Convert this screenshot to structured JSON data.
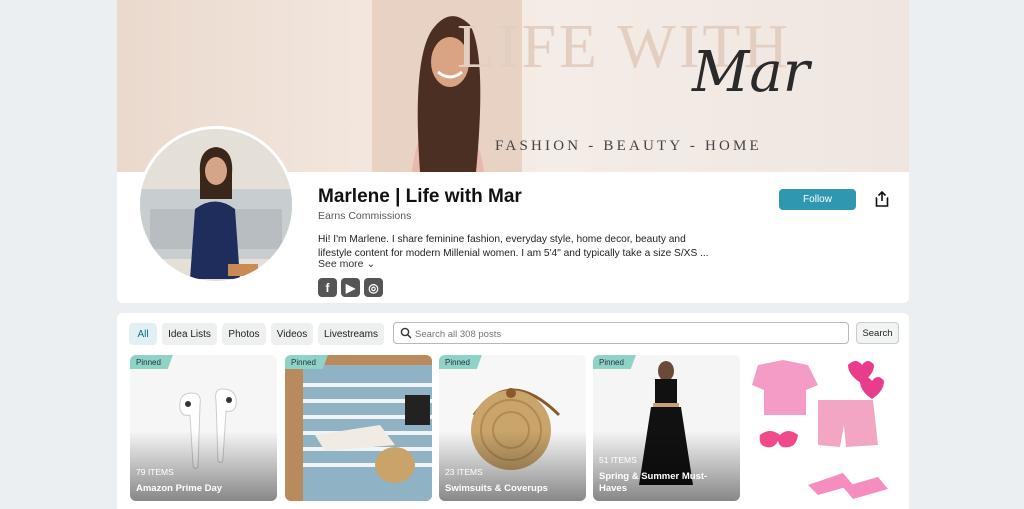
{
  "banner": {
    "title": "LIFE WITH",
    "script": "Mar",
    "tagline": "FASHION - BEAUTY - HOME"
  },
  "profile": {
    "name": "Marlene | Life with Mar",
    "earns": "Earns Commissions",
    "bio": "Hi! I'm Marlene. I share feminine fashion, everyday style, home decor, beauty and lifestyle content for modern Millenial women. I am 5'4\" and typically take a size S/XS ...",
    "see_more": "See more",
    "follow_label": "Follow",
    "socials": [
      {
        "name": "facebook-icon",
        "glyph": "f"
      },
      {
        "name": "youtube-icon",
        "glyph": "▶"
      },
      {
        "name": "instagram-icon",
        "glyph": "◎"
      }
    ]
  },
  "filters": [
    "All",
    "Idea Lists",
    "Photos",
    "Videos",
    "Livestreams"
  ],
  "search": {
    "placeholder": "Search all 308 posts",
    "button": "Search"
  },
  "posts": [
    {
      "pinned": "Pinned",
      "items": "79 ITEMS",
      "title": "Amazon Prime Day"
    },
    {
      "pinned": "Pinned",
      "items": "",
      "title": ""
    },
    {
      "pinned": "Pinned",
      "items": "23 ITEMS",
      "title": "Swimsuits & Coverups"
    },
    {
      "pinned": "Pinned",
      "items": "51 ITEMS",
      "title": "Spring & Summer Must-Haves"
    },
    {
      "pinned": "",
      "items": "",
      "title": ""
    }
  ],
  "colors": {
    "accent": "#2f98b0",
    "pinned": "#8fd3c6"
  }
}
